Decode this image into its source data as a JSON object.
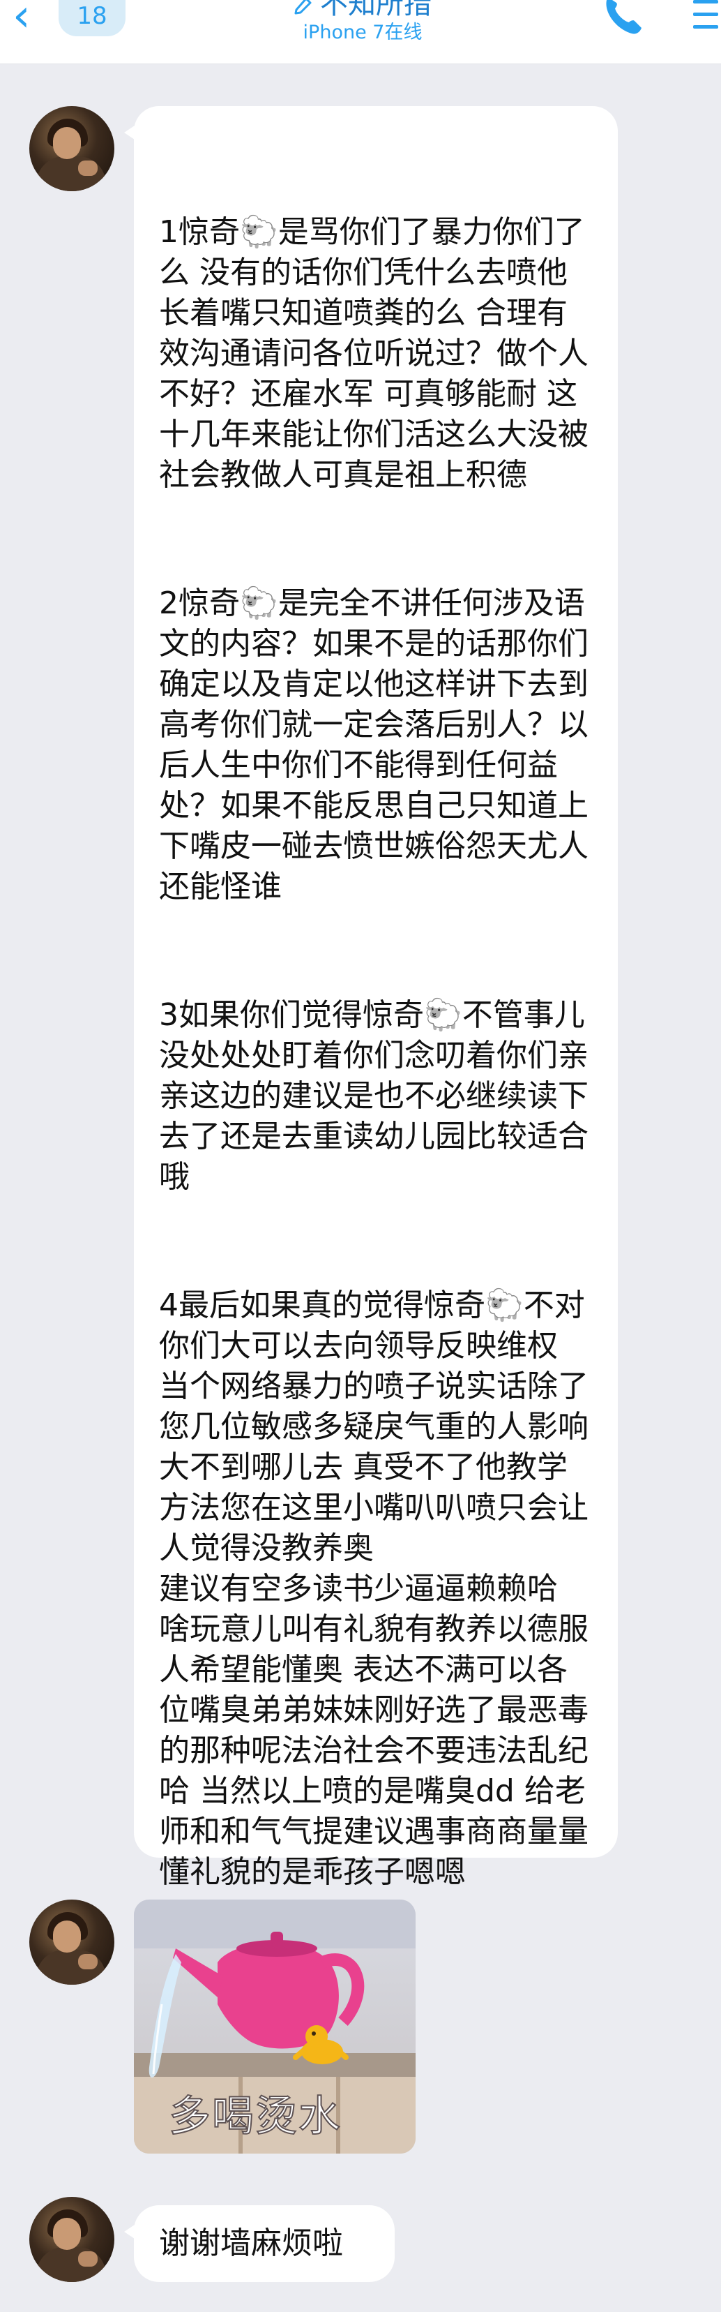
{
  "header": {
    "unread_count": "18",
    "title": "不知所措",
    "subtitle": "iPhone 7在线"
  },
  "messages": {
    "long_text": {
      "p1": "1惊奇🐑是骂你们了暴力你们了么 没有的话你们凭什么去喷他 长着嘴只知道喷粪的么 合理有效沟通请问各位听说过？做个人不好？还雇水军 可真够能耐 这十几年来能让你们活这么大没被社会教做人可真是祖上积德",
      "p2": "2惊奇🐑是完全不讲任何涉及语文的内容？如果不是的话那你们确定以及肯定以他这样讲下去到高考你们就一定会落后别人？以后人生中你们不能得到任何益处？如果不能反思自己只知道上下嘴皮一碰去愤世嫉俗怨天尤人还能怪谁",
      "p3": "3如果你们觉得惊奇🐑不管事儿没处处处盯着你们念叨着你们亲亲这边的建议是也不必继续读下去了还是去重读幼儿园比较适合哦",
      "p4": "4最后如果真的觉得惊奇🐑不对你们大可以去向领导反映维权 当个网络暴力的喷子说实话除了您几位敏感多疑戾气重的人影响大不到哪儿去 真受不了他教学方法您在这里小嘴叭叭喷只会让人觉得没教养奥\n建议有空多读书少逼逼赖赖哈 啥玩意儿叫有礼貌有教养以德服人希望能懂奥 表达不满可以各位嘴臭弟弟妹妹刚好选了最恶毒的那种呢法治社会不要违法乱纪哈 当然以上喷的是嘴臭dd 给老师和和气气提建议遇事商商量量懂礼貌的是乖孩子嗯嗯"
    },
    "sticker_caption": "多喝烫水",
    "last_text": "谢谢墙麻烦啦"
  },
  "icons": {
    "back": "chevron-left-icon",
    "title": "pencil-icon",
    "call": "phone-icon",
    "menu": "menu-icon",
    "sheep": "sheep-emoji-icon"
  },
  "colors": {
    "accent": "#2aa1f0",
    "background": "#ebecf1",
    "bubble": "#ffffff"
  }
}
